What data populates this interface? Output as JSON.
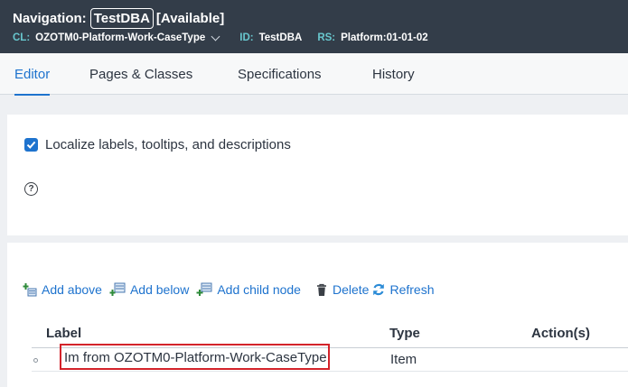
{
  "header": {
    "prefix": "Navigation:",
    "name": "TestDBA",
    "status": "[Available]",
    "cl_key": "CL:",
    "cl_value": "OZOTM0-Platform-Work-CaseType",
    "id_key": "ID:",
    "id_value": "TestDBA",
    "rs_key": "RS:",
    "rs_value": "Platform:01-01-02"
  },
  "tabs": [
    {
      "label": "Editor",
      "active": true
    },
    {
      "label": "Pages & Classes",
      "active": false
    },
    {
      "label": "Specifications",
      "active": false
    },
    {
      "label": "History",
      "active": false
    }
  ],
  "settings": {
    "localize_label": "Localize labels, tooltips, and descriptions",
    "localize_checked": true,
    "help_glyph": "?"
  },
  "toolbar": {
    "add_above": "Add above",
    "add_below": "Add below",
    "add_child": "Add child node",
    "delete": "Delete",
    "refresh": "Refresh"
  },
  "table": {
    "columns": [
      "Label",
      "Type",
      "Action(s)"
    ],
    "rows": [
      {
        "label": "Im from OZOTM0-Platform-Work-CaseType",
        "type": "Item",
        "highlighted": true
      }
    ]
  },
  "colors": {
    "header_bg": "#333d49",
    "accent": "#1e73ce",
    "meta_key": "#68c7ce",
    "highlight_border": "#d3232a"
  }
}
